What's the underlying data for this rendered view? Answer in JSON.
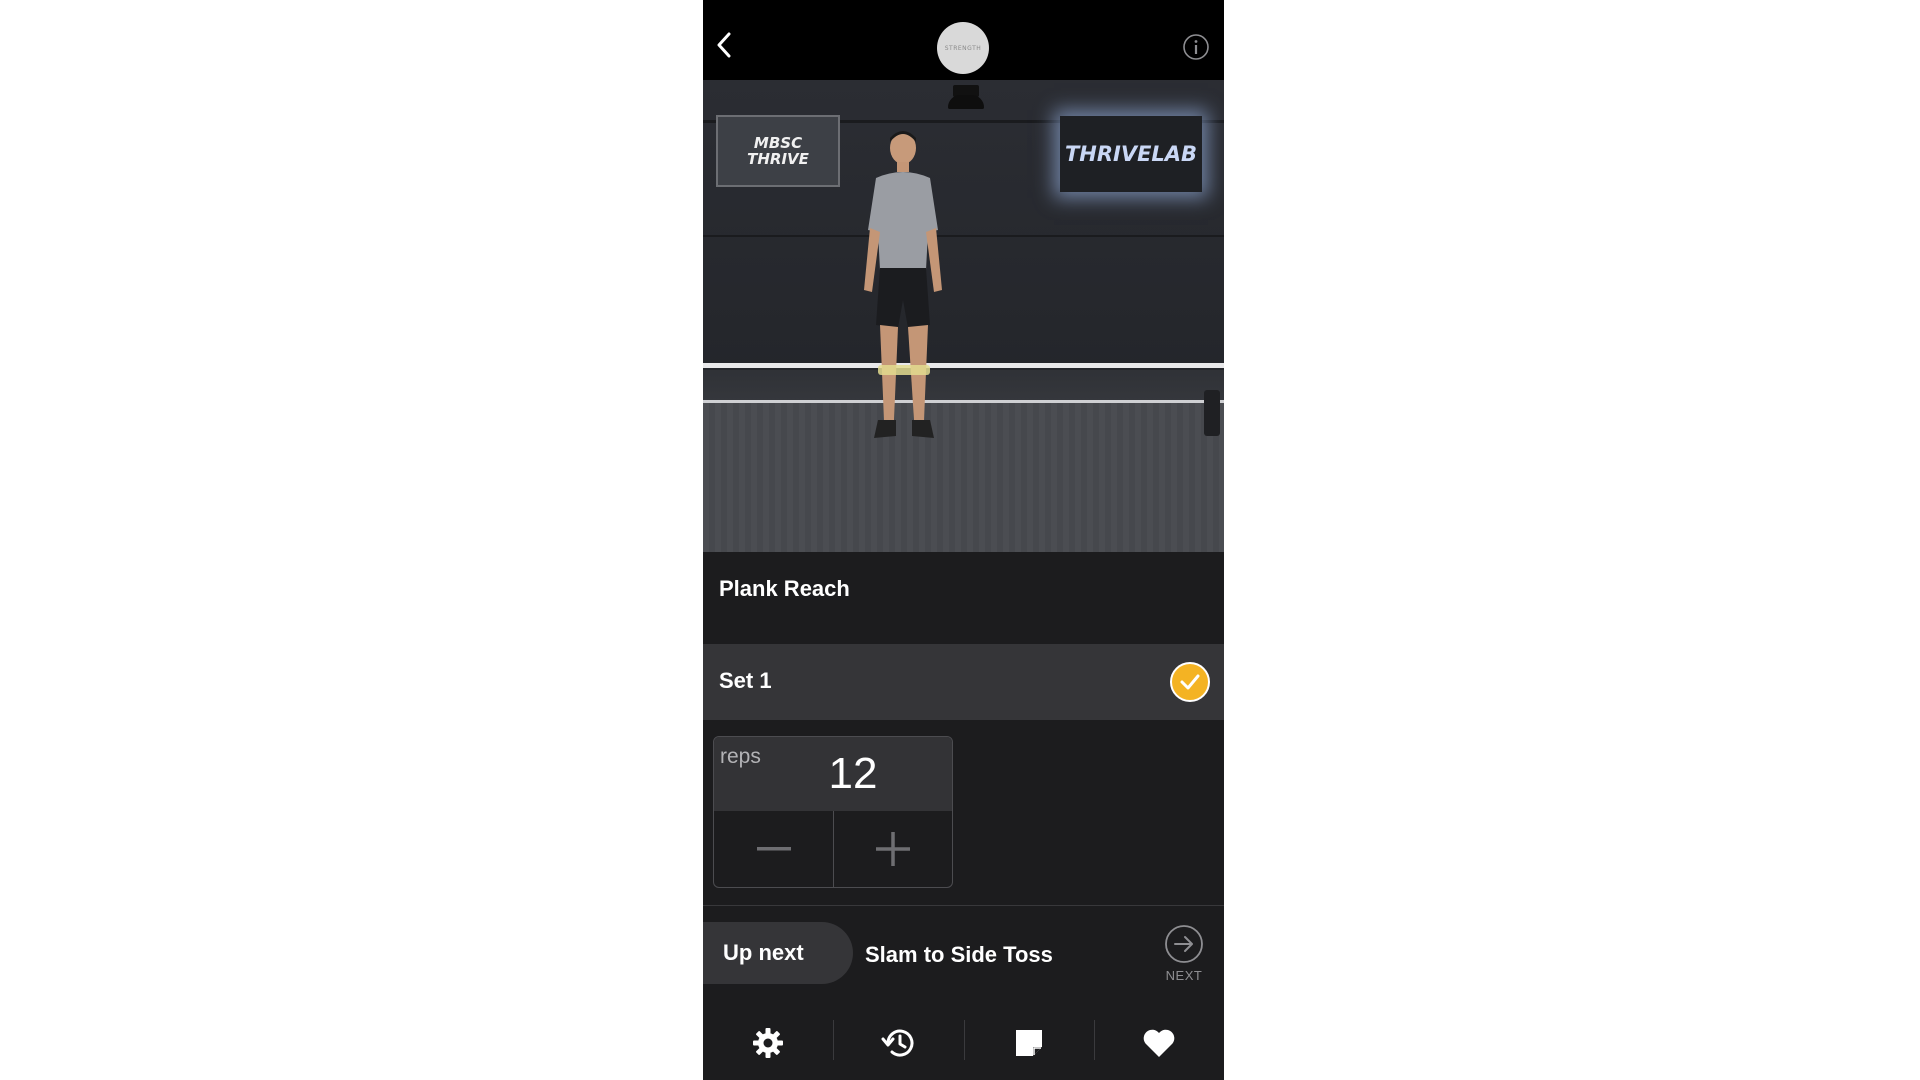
{
  "header": {
    "logo_text": "STRENGTH",
    "icons": {
      "back": "chevron-left-icon",
      "info": "info-circle-icon"
    }
  },
  "video": {
    "sign_left": "MBSC\nTHRIVE",
    "sign_right": "THRIVELAB"
  },
  "exercise": {
    "title": "Plank Reach"
  },
  "set": {
    "label": "Set 1",
    "completed": true,
    "check_color": "#f4b323"
  },
  "reps": {
    "label": "reps",
    "value": "12"
  },
  "up_next": {
    "label": "Up next",
    "exercise": "Slam to Side Toss",
    "next_label": "NEXT"
  },
  "toolbar": {
    "items": [
      {
        "icon": "gear-icon"
      },
      {
        "icon": "history-icon"
      },
      {
        "icon": "note-icon"
      },
      {
        "icon": "heart-icon"
      }
    ]
  }
}
